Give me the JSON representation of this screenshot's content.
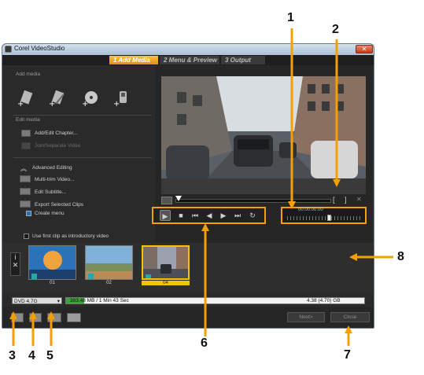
{
  "window": {
    "title": "Corel VideoStudio",
    "close_glyph": "✕"
  },
  "steps": [
    {
      "label": "1 Add Media",
      "active": true
    },
    {
      "label": "2 Menu & Preview",
      "active": false
    },
    {
      "label": "3 Output",
      "active": false
    }
  ],
  "left_panel": {
    "add_media_title": "Add media",
    "media_buttons": [
      "add-video-icon",
      "add-edit-video-icon",
      "add-disc-icon",
      "add-device-icon"
    ],
    "edit_media_title": "Edit media",
    "edit_items": [
      {
        "label": "Add/Edit Chapter...",
        "enabled": true
      },
      {
        "label": "Join/Separate Video",
        "enabled": false
      }
    ],
    "advanced_label": "Advanced Editing",
    "advanced_items": [
      {
        "label": "Multi-trim Video..."
      },
      {
        "label": "Edit Subtitle..."
      },
      {
        "label": "Export Selected Clips"
      }
    ],
    "create_menu_label": "Create menu",
    "create_menu_checked": true
  },
  "preview": {
    "timecode": "00:00:00:00",
    "mark_in": "[",
    "mark_out": "]",
    "clear_glyph": "✕",
    "scrub_position": 0.02,
    "volume_level": 0.57,
    "controls": {
      "play": "▶",
      "stop": "■",
      "start": "⏮",
      "prev_frame": "◀",
      "next_frame": "▶",
      "end": "⏭",
      "repeat": "↻"
    }
  },
  "intro_checkbox": {
    "label": "Use first clip as introductory video",
    "checked": false
  },
  "timeline": {
    "side_tools": [
      "i",
      "✕"
    ],
    "clips": [
      {
        "label": "01",
        "selected": false
      },
      {
        "label": "02",
        "selected": false
      },
      {
        "label": "04",
        "selected": true
      }
    ]
  },
  "status": {
    "disc": "DVD 4.7G",
    "used": "383.48 MB / 1 Min 43 Sec",
    "capacity": "4.38 (4.70) GB",
    "used_fraction": 0.06
  },
  "bottom": {
    "icons": [
      "project-settings-icon",
      "capture-settings-icon",
      "ratio-icon",
      "print-icon"
    ],
    "next_label": "Next>",
    "close_label": "Close"
  },
  "callouts": [
    "1",
    "2",
    "3",
    "4",
    "5",
    "6",
    "7",
    "8"
  ],
  "colors": {
    "highlight": "#f5a000",
    "accent_step": "#f0a92a",
    "selected_clip": "#f5c400"
  }
}
